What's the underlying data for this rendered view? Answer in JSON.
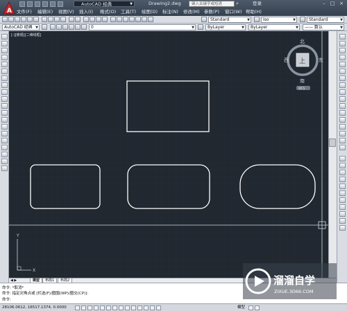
{
  "title_bar": {
    "logo_letter": "A",
    "workspace": "AutoCAD 经典",
    "document_title": "Drawing2.dwg",
    "search_placeholder": "键入关键字或短语",
    "login_label": "登录",
    "win_min": "–",
    "win_max": "□",
    "win_close": "×"
  },
  "menu": [
    "文件(F)",
    "编辑(E)",
    "视图(V)",
    "插入(I)",
    "格式(O)",
    "工具(T)",
    "绘图(D)",
    "标注(N)",
    "修改(M)",
    "参数(P)",
    "窗口(W)",
    "帮助(H)"
  ],
  "toolbar1": {
    "textstyle": "Standard",
    "dimstyle": "Standard",
    "tablestyle": "Standard",
    "multileader": "Standard",
    "iso_label": "Iso"
  },
  "toolbar2": {
    "workspace_combo": "AutoCAD 经典",
    "layer_combo": "0",
    "color_combo": "ByLayer",
    "linetype_combo": "ByLayer",
    "lineweight_combo": "—— 数认"
  },
  "viewport": {
    "control_label": "[-][俯视][二维线框]",
    "viewcube_face": "上",
    "compass": {
      "n": "北",
      "s": "南",
      "e": "东",
      "w": "西"
    },
    "wcs_label": "WCS",
    "ucs_x": "X",
    "ucs_y": "Y"
  },
  "layout_tabs": [
    "模型",
    "布局1",
    "布局2"
  ],
  "command_lines": [
    "命令: *取消*",
    "命令: 指定对角点或 [栏选(F)/圈围(WP)/圈交(CP)]:",
    "命令:"
  ],
  "status": {
    "coordinates": "28106.0612, 16517.1374, 0.0000",
    "model_label": "模型"
  },
  "watermark": {
    "title": "溜溜自学",
    "url": "ZIXUE.3D66.COM"
  },
  "colors": {
    "canvas": "#212830",
    "shape_stroke": "#ffffff",
    "grid": "#2a323c"
  }
}
